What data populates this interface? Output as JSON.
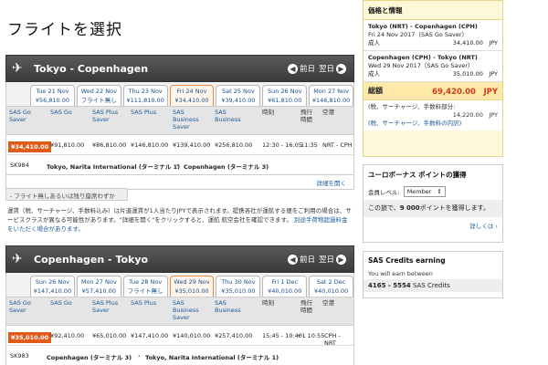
{
  "title": "フライトを選択",
  "fare_columns": [
    "SAS Go\nSaver",
    "SAS Go",
    "SAS Plus\nSaver",
    "SAS Plus",
    "SAS\nBusiness\nSaver",
    "SAS\nBusiness",
    "時刻",
    "飛行\n時間",
    "空港"
  ],
  "outbound": {
    "route": "Tokyo  -  Copenhagen",
    "prev": "前日",
    "next": "翌日",
    "dates": [
      {
        "day": "Tue 21 Nov",
        "price": "¥56,810.00",
        "selected": false
      },
      {
        "day": "Wed 22 Nov",
        "price": "フライト無し",
        "selected": false
      },
      {
        "day": "Thu 23 Nov",
        "price": "¥111,810.00",
        "selected": false
      },
      {
        "day": "Fri 24 Nov",
        "price": "¥34,410.00",
        "selected": true
      },
      {
        "day": "Sat 25 Nov",
        "price": "¥39,410.00",
        "selected": false
      },
      {
        "day": "Sun 26 Nov",
        "price": "¥61,810.00",
        "selected": false
      },
      {
        "day": "Mon 27 Nov",
        "price": "¥146,810.00",
        "selected": false
      }
    ],
    "fares": [
      "¥34,410.00",
      "¥91,810.00",
      "¥86,810.00",
      "¥146,810.00",
      "¥139,410.00",
      "¥256,810.00"
    ],
    "time": "12:30 - 16:05",
    "duration": "11:35",
    "airports": "NRT - CPH",
    "flight_no": "SK984",
    "from": "Tokyo, Narita International (ターミナル 1)",
    "to": "Copenhagen (ターミナル 3)",
    "details": "詳細を開く"
  },
  "remaining": "- フライト無しあるいは残り座席わずか",
  "notice": {
    "text": "運賃（税、サーチャージ、手数料込み）は片道運賃が1人当たりJPYで表示されます。提携各社が運航する便をご利用の場合は、サービスクラスが異なる可能性があります。\"詳細を開く\"をクリックすると、運航 航空会社を確認できます。",
    "link": "別途手荷物超過料金をいただく場合があります。"
  },
  "inbound": {
    "route": "Copenhagen  -  Tokyo",
    "prev": "前日",
    "next": "翌日",
    "dates": [
      {
        "day": "Sun 26 Nov",
        "price": "¥147,410.00",
        "selected": false
      },
      {
        "day": "Mon 27 Nov",
        "price": "¥57,410.00",
        "selected": false
      },
      {
        "day": "Tue 28 Nov",
        "price": "フライト無し",
        "selected": false
      },
      {
        "day": "Wed 29 Nov",
        "price": "¥35,010.00",
        "selected": true
      },
      {
        "day": "Thu 30 Nov",
        "price": "¥35,010.00",
        "selected": false
      },
      {
        "day": "Fri 1 Dec",
        "price": "¥40,010.00",
        "selected": false
      },
      {
        "day": "Sat 2 Dec",
        "price": "¥40,010.00",
        "selected": false
      }
    ],
    "fares": [
      "¥35,010.00",
      "¥92,410.00",
      "¥65,010.00",
      "¥147,410.00",
      "¥140,010.00",
      "¥257,410.00"
    ],
    "time": "15:45 - 10:40",
    "duration": "+1 10:55",
    "airports": "CPH - NRT",
    "flight_no": "SK983",
    "from": "Copenhagen (ターミナル 3)",
    "to": "Tokyo, Narita International (ターミナル 1)"
  },
  "price_box": {
    "title": "価格と情報",
    "seg1_route": "Tokyo (NRT) - Copenhagen (CPH)",
    "seg1_date": "Fri 24 Nov 2017（SAS Go Saver）",
    "seg1_pax": "成人",
    "seg1_price": "34,410.00　JPY",
    "seg2_route": "Copenhagen (CPH) - Tokyo (NRT)",
    "seg2_date": "Wed 29 Nov 2017（SAS Go Saver）",
    "seg2_pax": "成人",
    "seg2_price": "35,010.00　JPY",
    "total_label": "総額",
    "total": "69,420.00　JPY",
    "fee_label": "税、サーチャージ、手数料部分:",
    "fee_value": "14,220.00　JPY",
    "fee_link": "税、サーチャージ、手数料の内訳"
  },
  "bonus": {
    "title": "ユーロボーナス ポイントの獲得",
    "level_label": "会員レベル:",
    "level_value": "Member",
    "info_pre": "この旅で、",
    "points": "9 000",
    "info_post": "ポイントを獲得します。",
    "more": "詳しくは"
  },
  "credits": {
    "title": "SAS Credits earning",
    "text": "You will earn between",
    "range": "4165 - 5554",
    "unit": "SAS Credits"
  }
}
